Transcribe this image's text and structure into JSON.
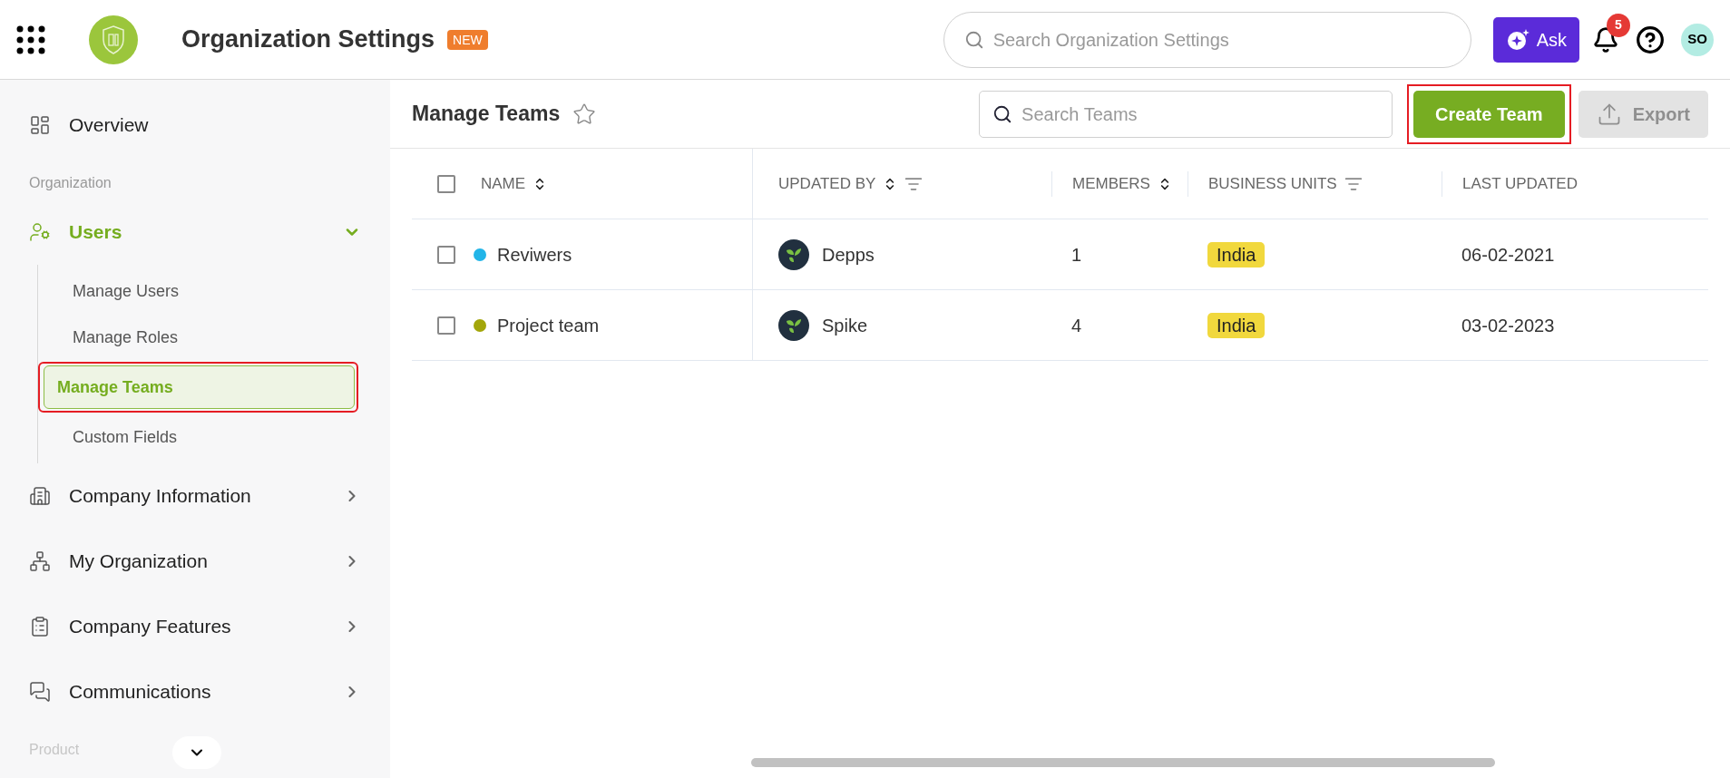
{
  "header": {
    "title": "Organization Settings",
    "badge": "NEW",
    "search": {
      "placeholder": "Search Organization Settings"
    },
    "ask_button": "Ask",
    "notifications": "5",
    "avatar": "SO"
  },
  "sidebar": {
    "items": [
      {
        "kind": "link",
        "label": "Overview"
      },
      {
        "kind": "section",
        "label": "Organization"
      },
      {
        "kind": "group",
        "label": "Users",
        "expanded": true,
        "children": [
          {
            "label": "Manage Users",
            "selected": false,
            "highlighted": false
          },
          {
            "label": "Manage Roles",
            "selected": false,
            "highlighted": false
          },
          {
            "label": "Manage Teams",
            "selected": true,
            "highlighted": true
          },
          {
            "label": "Custom Fields",
            "selected": false,
            "highlighted": false
          }
        ]
      },
      {
        "kind": "group",
        "label": "Company Information",
        "expanded": false
      },
      {
        "kind": "group",
        "label": "My Organization",
        "expanded": false
      },
      {
        "kind": "group",
        "label": "Company Features",
        "expanded": false
      },
      {
        "kind": "group",
        "label": "Communications",
        "expanded": false
      },
      {
        "kind": "section",
        "label": "Product"
      }
    ]
  },
  "page": {
    "title": "Manage Teams",
    "starred": false,
    "search": {
      "placeholder": "Search Teams"
    },
    "create_button": {
      "label": "Create Team",
      "highlighted": true
    },
    "export_button": {
      "label": "Export",
      "disabled": true
    }
  },
  "table": {
    "all_checked": false,
    "columns": [
      {
        "label": "NAME",
        "sort": true,
        "filter": false
      },
      {
        "label": "UPDATED BY",
        "sort": true,
        "filter": true
      },
      {
        "label": "MEMBERS",
        "sort": true,
        "filter": false
      },
      {
        "label": "BUSINESS UNITS",
        "sort": false,
        "filter": true
      },
      {
        "label": "LAST UPDATED",
        "sort": false,
        "filter": false
      }
    ],
    "rows": [
      {
        "checked": false,
        "color": "#22b5e8",
        "name": "Reviwers",
        "updated_by": "Depps",
        "members": "1",
        "business_unit": "India",
        "last_updated": "06-02-2021"
      },
      {
        "checked": false,
        "color": "#a3a60a",
        "name": "Project team",
        "updated_by": "Spike",
        "members": "4",
        "business_unit": "India",
        "last_updated": "03-02-2023"
      }
    ]
  }
}
